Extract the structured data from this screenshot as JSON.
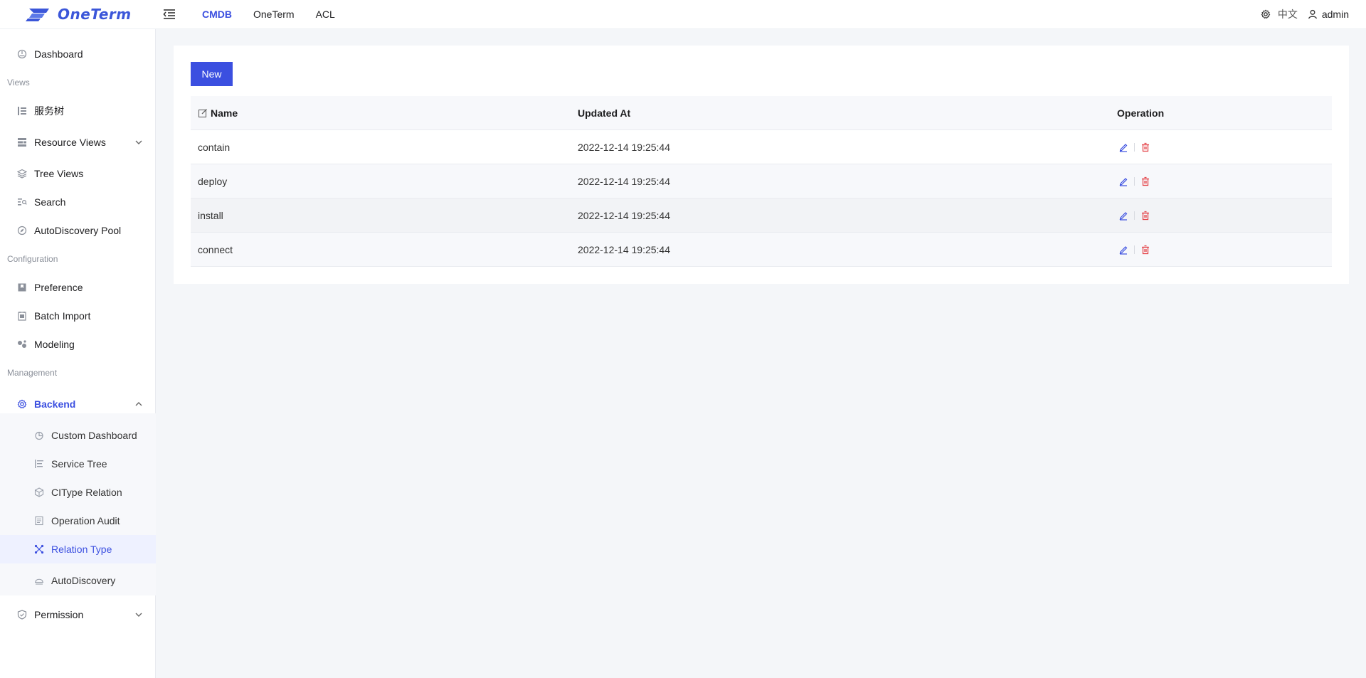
{
  "brand": {
    "name": "OneTerm",
    "accent": "#3b4fe0",
    "danger": "#e5484d"
  },
  "topnav": [
    {
      "label": "CMDB",
      "active": true
    },
    {
      "label": "OneTerm",
      "active": false
    },
    {
      "label": "ACL",
      "active": false
    }
  ],
  "header_right": {
    "language": "中文",
    "user": "admin"
  },
  "sidebar": {
    "dashboard": "Dashboard",
    "group_views": "Views",
    "service_tree_cn": "服务树",
    "resource_views": "Resource Views",
    "tree_views": "Tree Views",
    "search": "Search",
    "autodiscovery_pool": "AutoDiscovery Pool",
    "group_configuration": "Configuration",
    "preference": "Preference",
    "batch_import": "Batch Import",
    "modeling": "Modeling",
    "group_management": "Management",
    "backend": "Backend",
    "backend_items": [
      {
        "label": "Custom Dashboard"
      },
      {
        "label": "Service Tree"
      },
      {
        "label": "CIType Relation"
      },
      {
        "label": "Operation Audit"
      },
      {
        "label": "Relation Type"
      },
      {
        "label": "AutoDiscovery"
      }
    ],
    "permission": "Permission"
  },
  "main": {
    "new_button": "New",
    "columns": {
      "name": "Name",
      "updated_at": "Updated At",
      "operation": "Operation"
    },
    "rows": [
      {
        "name": "contain",
        "updated_at": "2022-12-14 19:25:44"
      },
      {
        "name": "deploy",
        "updated_at": "2022-12-14 19:25:44"
      },
      {
        "name": "install",
        "updated_at": "2022-12-14 19:25:44"
      },
      {
        "name": "connect",
        "updated_at": "2022-12-14 19:25:44"
      }
    ]
  }
}
